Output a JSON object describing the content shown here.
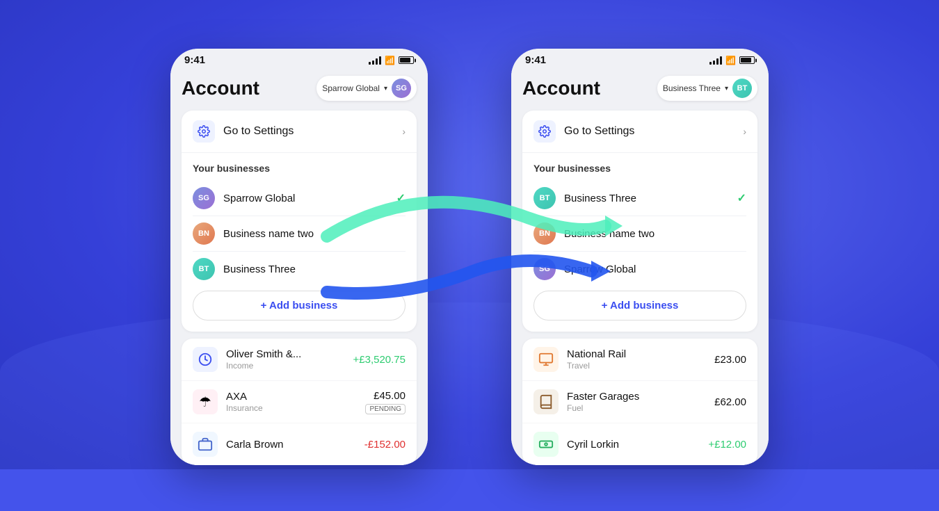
{
  "background": {
    "color": "#3f4de8"
  },
  "phone1": {
    "status_time": "9:41",
    "account_title": "Account",
    "switcher_label": "Sparrow Global",
    "switcher_avatar_initials": "SG",
    "settings_label": "Go to Settings",
    "businesses_section_title": "Your businesses",
    "businesses": [
      {
        "initials": "SG",
        "name": "Sparrow Global",
        "selected": true,
        "avatar_class": "avatar-sg"
      },
      {
        "initials": "BN",
        "name": "Business name two",
        "selected": false,
        "avatar_class": "avatar-bn"
      },
      {
        "initials": "BT",
        "name": "Business Three",
        "selected": false,
        "avatar_class": "avatar-bt"
      }
    ],
    "add_business_label": "+ Add business",
    "transactions": [
      {
        "icon": "🔵",
        "name": "Oliver Smith &...",
        "category": "Income",
        "amount": "+£3,520.75",
        "income": true,
        "pending": false
      },
      {
        "icon": "☂",
        "name": "AXA",
        "category": "Insurance",
        "amount": "£45.00",
        "income": false,
        "pending": true
      },
      {
        "icon": "💼",
        "name": "Carla Brown",
        "category": "",
        "amount": "-£152.00",
        "income": false,
        "pending": false
      }
    ]
  },
  "phone2": {
    "status_time": "9:41",
    "account_title": "Account",
    "switcher_label": "Business Three",
    "switcher_avatar_initials": "BT",
    "settings_label": "Go to Settings",
    "businesses_section_title": "Your businesses",
    "businesses": [
      {
        "initials": "BT",
        "name": "Business Three",
        "selected": true,
        "avatar_class": "avatar-bt"
      },
      {
        "initials": "BN",
        "name": "Business name two",
        "selected": false,
        "avatar_class": "avatar-bn"
      },
      {
        "initials": "SG",
        "name": "Sparrow Global",
        "selected": false,
        "avatar_class": "avatar-sg"
      }
    ],
    "add_business_label": "+ Add business",
    "transactions": [
      {
        "icon": "🟧",
        "name": "National Rail",
        "category": "Travel",
        "amount": "£23.00",
        "income": false,
        "pending": false
      },
      {
        "icon": "📒",
        "name": "Faster Garages",
        "category": "Fuel",
        "amount": "£62.00",
        "income": false,
        "pending": false
      },
      {
        "icon": "🟩",
        "name": "Cyril Lorkin",
        "category": "",
        "amount": "+£12.00",
        "income": true,
        "pending": false
      }
    ]
  },
  "arrows": {
    "green_label": "",
    "blue_label": ""
  }
}
